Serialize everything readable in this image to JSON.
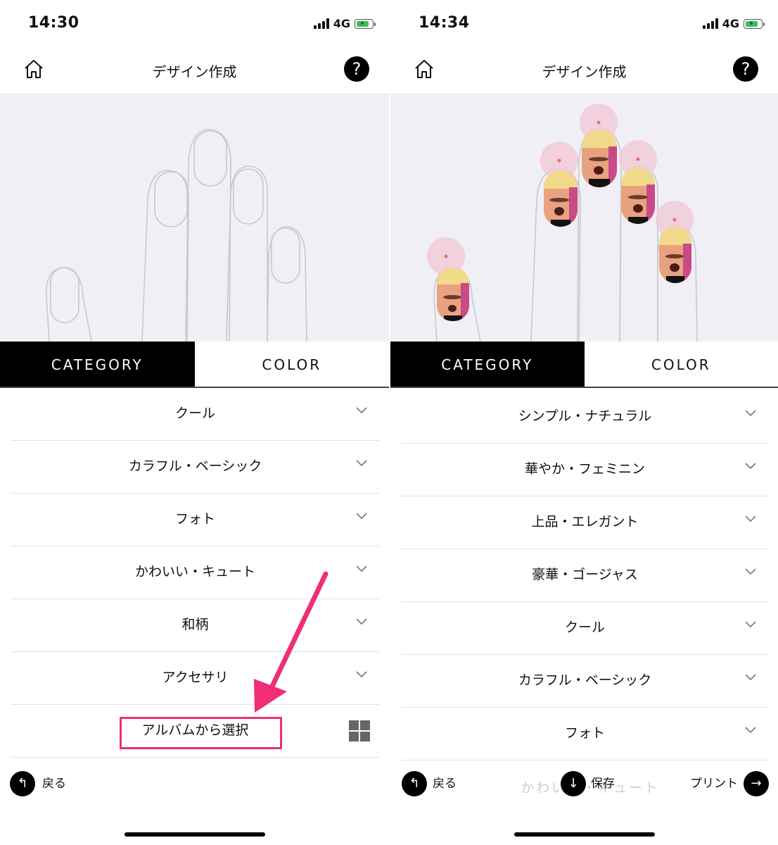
{
  "left": {
    "status": {
      "time": "14:30",
      "network": "4G"
    },
    "nav": {
      "title": "デザイン作成",
      "help": "?"
    },
    "tabs": {
      "category": "CATEGORY",
      "color": "COLOR"
    },
    "categories": [
      "クール",
      "カラフル・ベーシック",
      "フォト",
      "かわいい・キュート",
      "和柄",
      "アクセサリ"
    ],
    "album_label": "アルバムから選択",
    "footer": {
      "back_label": "戻る"
    }
  },
  "right": {
    "status": {
      "time": "14:34",
      "network": "4G"
    },
    "nav": {
      "title": "デザイン作成",
      "help": "?"
    },
    "tabs": {
      "category": "CATEGORY",
      "color": "COLOR"
    },
    "categories": [
      "シンプル・ナチュラル",
      "華やか・フェミニン",
      "上品・エレガント",
      "豪華・ゴージャス",
      "クール",
      "カラフル・ベーシック",
      "フォト"
    ],
    "footer": {
      "back_label": "戻る",
      "save_label": "保存",
      "print_label": "プリント",
      "faded_text": "かわいい・キュート"
    }
  },
  "colors": {
    "accent": "#ee2f78",
    "tab_active_bg": "#000000",
    "canvas_bg": "#f0eff6",
    "battery": "#3bc15a"
  },
  "icons": {
    "home": "home-icon",
    "help": "help-icon",
    "chevron": "chevron-down-icon",
    "grid": "grid-icon",
    "back": "back-arrow-icon",
    "save": "download-icon",
    "print": "forward-arrow-icon"
  }
}
